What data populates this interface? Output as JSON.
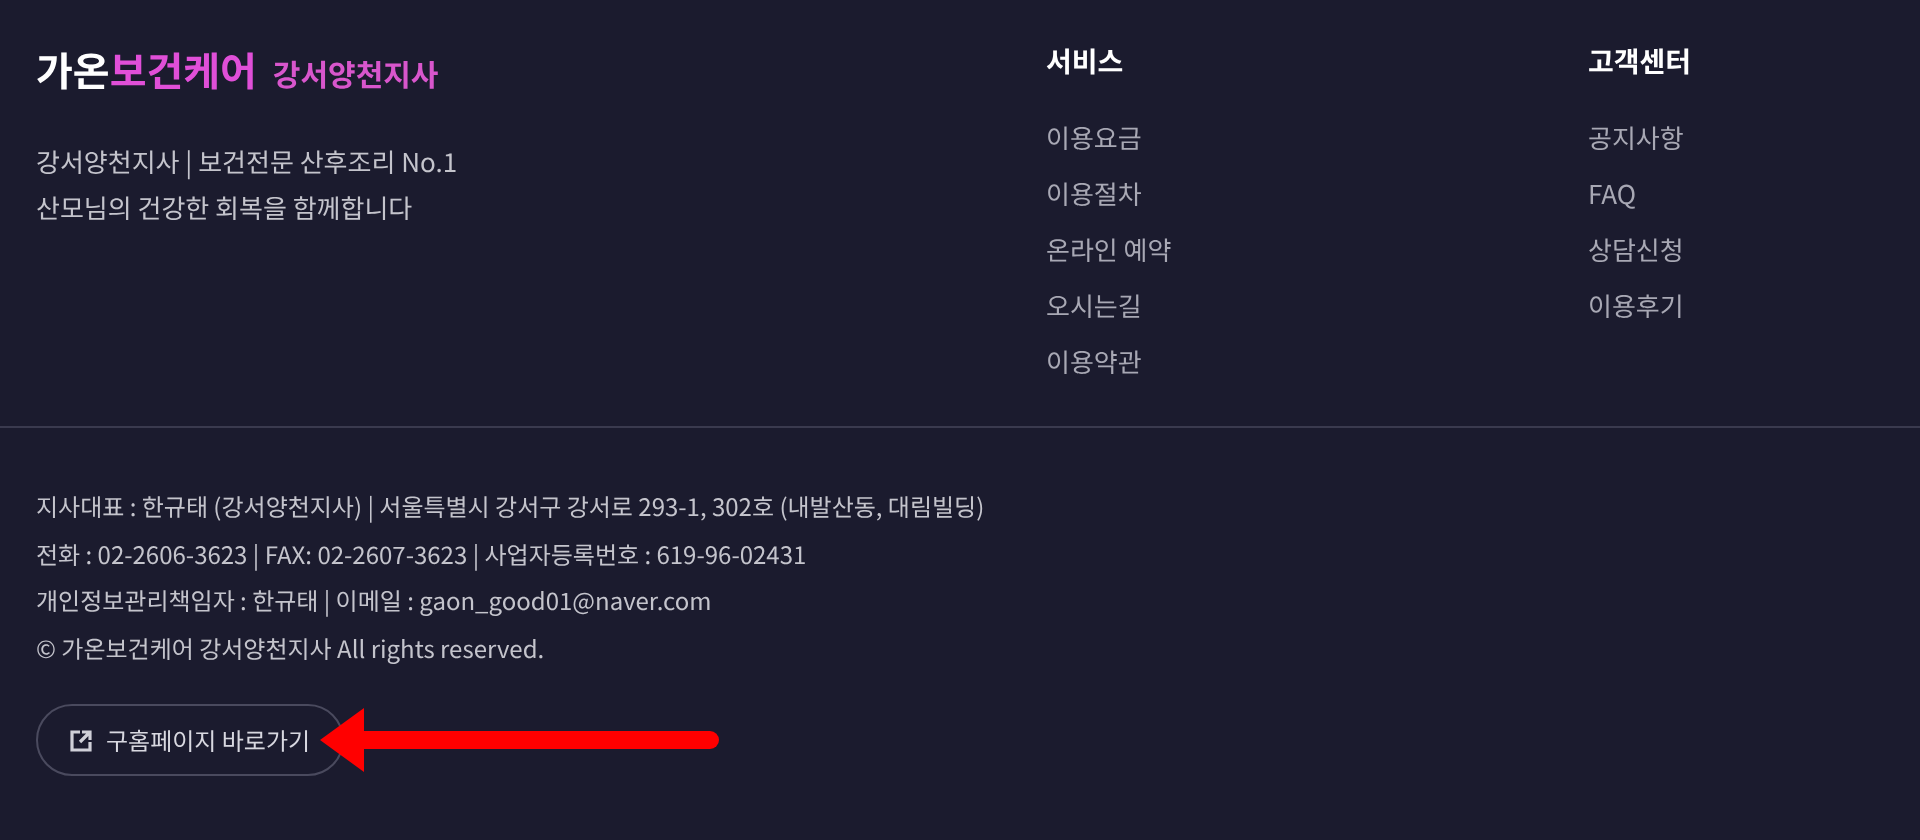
{
  "brand": {
    "logo_parts": [
      {
        "text": "가온",
        "accent": false
      },
      {
        "text": "보건케어",
        "accent": true
      }
    ],
    "branch": "강서양천지사"
  },
  "tagline": [
    "강서양천지사 | 보건전문 산후조리 No.1",
    "산모님의 건강한 회복을 함께합니다"
  ],
  "columns": [
    {
      "title": "서비스",
      "links": [
        "이용요금",
        "이용절차",
        "온라인 예약",
        "오시는길",
        "이용약관"
      ]
    },
    {
      "title": "고객센터",
      "links": [
        "공지사항",
        "FAQ",
        "상담신청",
        "이용후기"
      ]
    }
  ],
  "info": [
    "지사대표 : 한규태 (강서양천지사) | 서울특별시 강서구 강서로 293-1, 302호 (내발산동, 대림빌딩)",
    "전화 : 02-2606-3623 | FAX: 02-2607-3623 | 사업자등록번호 : 619-96-02431",
    "개인정보관리책임자 : 한규태 | 이메일 : gaon_good01@naver.com",
    "© 가온보건케어 강서양천지사 All rights reserved."
  ],
  "old_site_button": {
    "label": "구홈페이지 바로가기"
  }
}
